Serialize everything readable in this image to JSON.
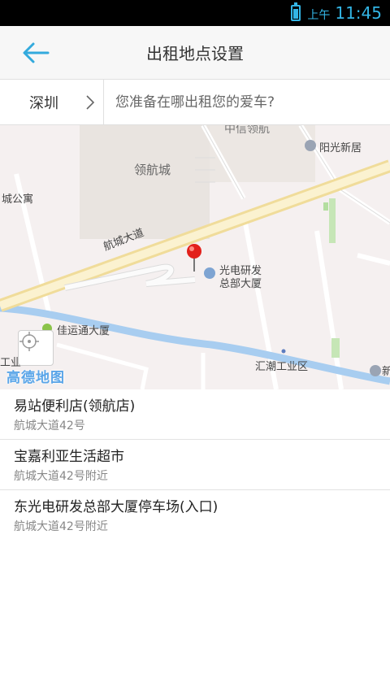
{
  "status_bar": {
    "ampm": "上午",
    "time": "11:45"
  },
  "header": {
    "title": "出租地点设置"
  },
  "search": {
    "city": "深圳",
    "placeholder": "您准备在哪出租您的爱车?"
  },
  "map": {
    "brand": "高德地图",
    "labels": {
      "zhongxin": "中信领航",
      "linghangcheng": "领航城",
      "yangguang": "阳光新居",
      "chenggongyu": "城公寓",
      "hangcheng_road": "航城大道",
      "guangdian_1": "光电研发",
      "guangdian_2": "总部大厦",
      "jiayuntong": "佳运通大厦",
      "huichao": "汇潮工业区",
      "gongye": "工业",
      "xin": "新"
    }
  },
  "results": [
    {
      "name": "易站便利店(领航店)",
      "address": "航城大道42号"
    },
    {
      "name": "宝嘉利亚生活超市",
      "address": "航城大道42号附近"
    },
    {
      "name": "东光电研发总部大厦停车场(入口)",
      "address": "航城大道42号附近"
    }
  ]
}
